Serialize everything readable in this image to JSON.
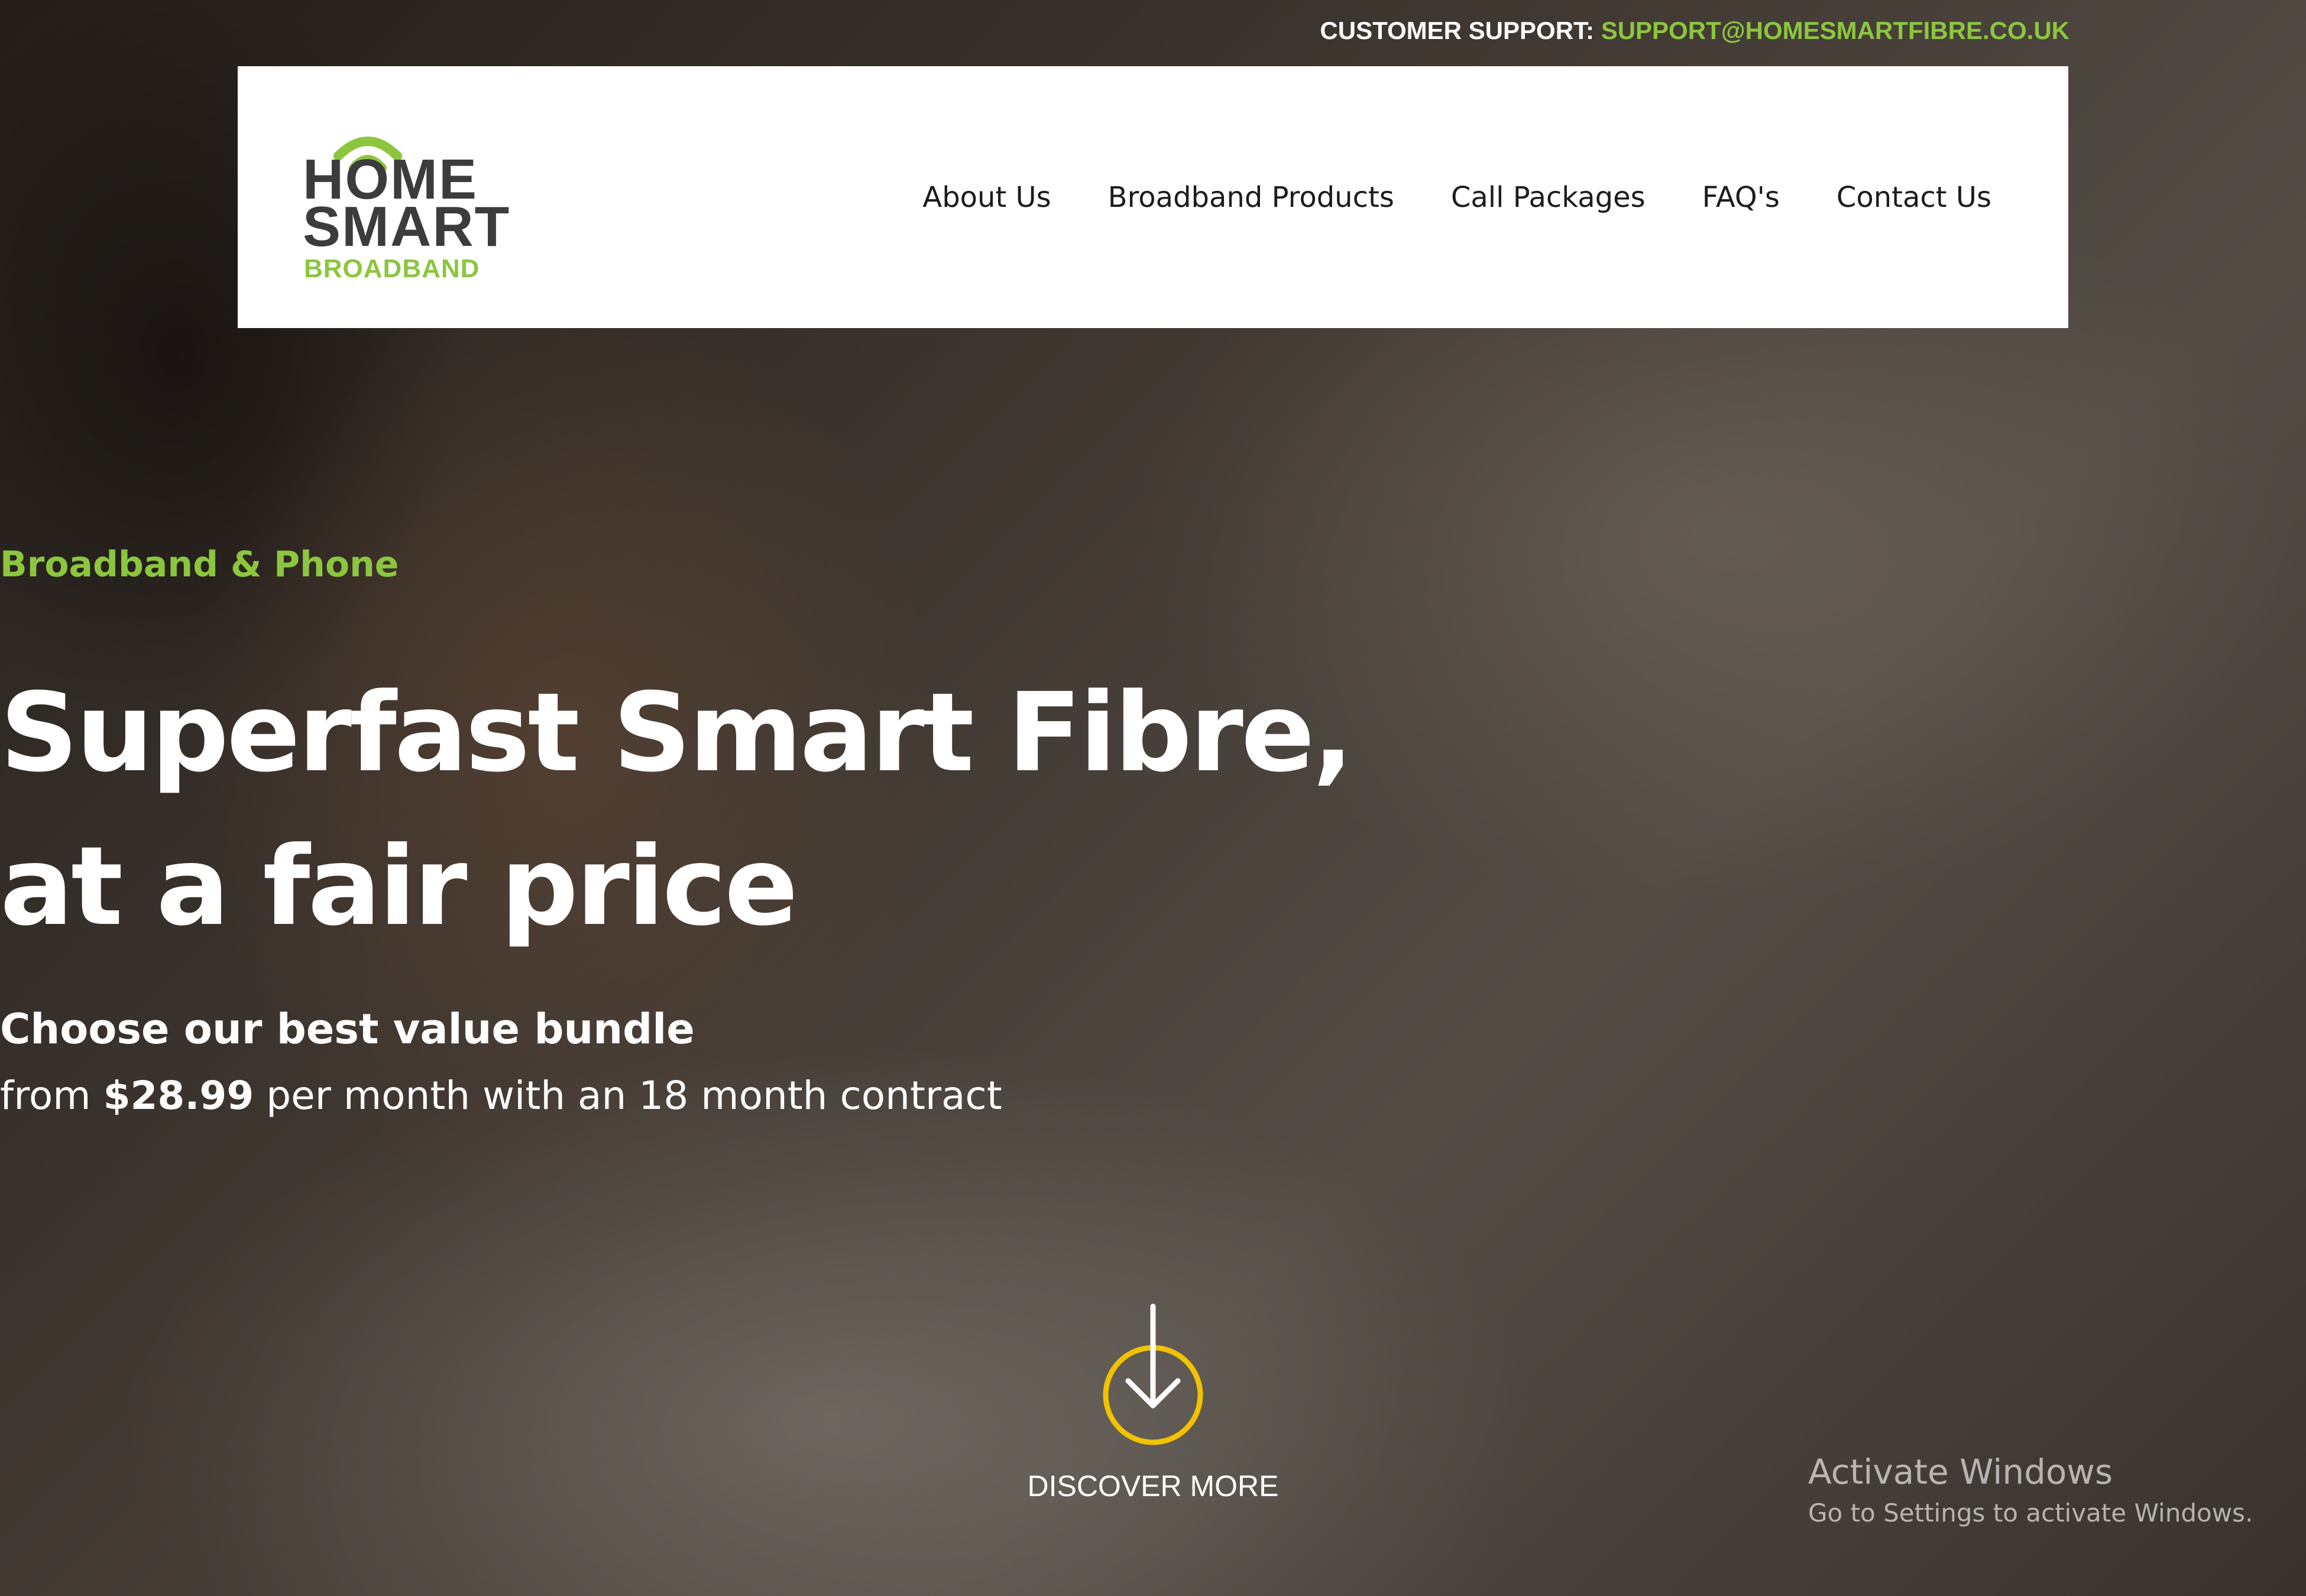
{
  "header": {
    "support_label": "CUSTOMER SUPPORT:",
    "support_email": "SUPPORT@HOMESMARTFIBRE.CO.UK"
  },
  "logo": {
    "line1": "HOME",
    "line2": "SMART",
    "line3": "BROADBAND",
    "accent_color": "#8cc63f"
  },
  "nav": {
    "items": [
      {
        "label": "About Us"
      },
      {
        "label": "Broadband Products"
      },
      {
        "label": "Call Packages"
      },
      {
        "label": "FAQ's"
      },
      {
        "label": "Contact Us"
      }
    ]
  },
  "hero": {
    "eyebrow": "Broadband & Phone",
    "headline_line1": "Superfast Smart Fibre,",
    "headline_line2": "at a fair price",
    "subhead": "Choose our best value bundle",
    "price_prefix": "from",
    "price": "$28.99",
    "price_suffix": "per month with an 18 month contract",
    "discover_label": "DISCOVER MORE",
    "discover_icon": "arrow-down-circle-icon",
    "discover_accent": "#f2c200"
  },
  "os_overlay": {
    "title": "Activate Windows",
    "subtitle": "Go to Settings to activate Windows."
  }
}
